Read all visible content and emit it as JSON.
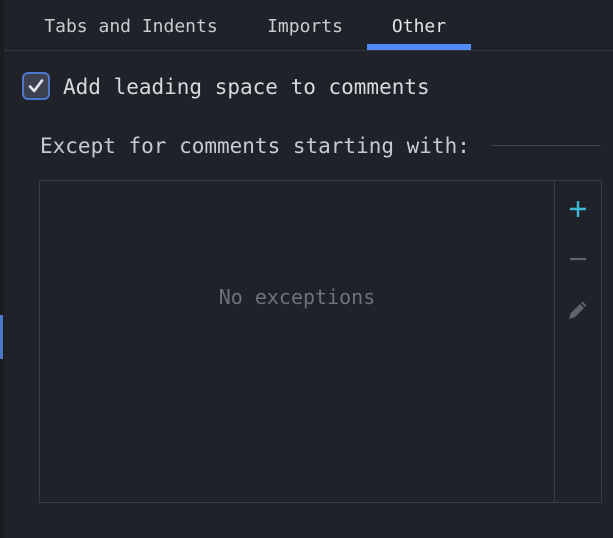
{
  "tabs": [
    {
      "label": "Tabs and Indents"
    },
    {
      "label": "Imports"
    },
    {
      "label": "Other"
    }
  ],
  "active_tab": "Other",
  "option": {
    "label": "Add leading space to comments",
    "checked": true
  },
  "exceptions": {
    "title": "Except for comments starting with:",
    "empty_text": "No exceptions",
    "tools": {
      "add": "plus-icon",
      "remove": "minus-icon",
      "edit": "pencil-icon"
    }
  },
  "colors": {
    "background": "#1f2228",
    "accent": "#548af7",
    "add_icon": "#3fb7d9"
  }
}
